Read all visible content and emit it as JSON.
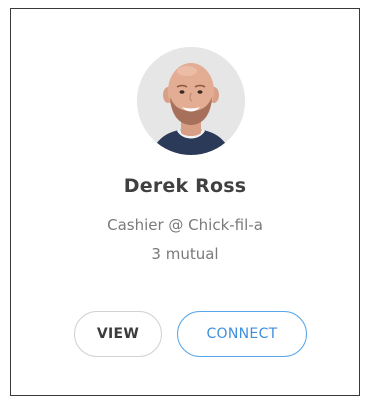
{
  "card": {
    "avatar_alt": "Derek Ross profile photo",
    "name": "Derek Ross",
    "role": "Cashier @ Chick-fil-a",
    "mutual": "3 mutual",
    "view_label": "VIEW",
    "connect_label": "CONNECT"
  },
  "colors": {
    "name_text": "#404040",
    "secondary_text": "#7a7a7a",
    "connect_accent": "#3f8fdc",
    "card_border": "#3a3a3a"
  }
}
